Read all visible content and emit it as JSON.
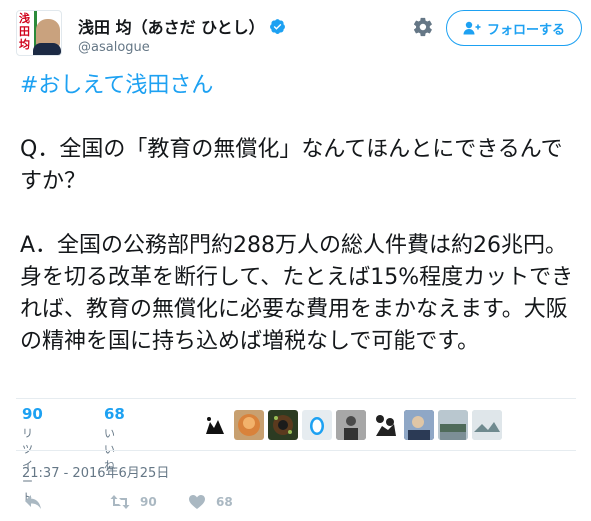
{
  "author": {
    "display_name": "浅田 均（あさだ ひとし）",
    "handle": "@asalogue",
    "avatar_text": "浅田均"
  },
  "follow_button": {
    "label": "フォローする"
  },
  "tweet": {
    "hashtag": "#おしえて浅田さん",
    "question": "Q．全国の「教育の無償化」なんてほんとにできるんですか？",
    "answer": "A．全国の公務部門約288万人の総人件費は約26兆円。身を切る改革を断行して、たとえば15%程度カットできれば、教育の無償化に必要な費用をまかなえます。大阪の精神を国に持ち込めば増税なしで可能です。"
  },
  "stats": {
    "retweets": {
      "count": "90",
      "label": "リツイート"
    },
    "likes": {
      "count": "68",
      "label": "いいね"
    }
  },
  "timestamp": "21:37 - 2016年6月25日",
  "actions": {
    "retweet_count": "90",
    "like_count": "68"
  },
  "colors": {
    "accent": "#1da1f2",
    "text": "#14171a",
    "muted": "#657786",
    "icon_gray": "#aab8c2"
  },
  "icons": [
    "verified-badge-icon",
    "gear-icon",
    "follow-user-icon",
    "reply-icon",
    "retweet-icon",
    "heart-icon"
  ]
}
